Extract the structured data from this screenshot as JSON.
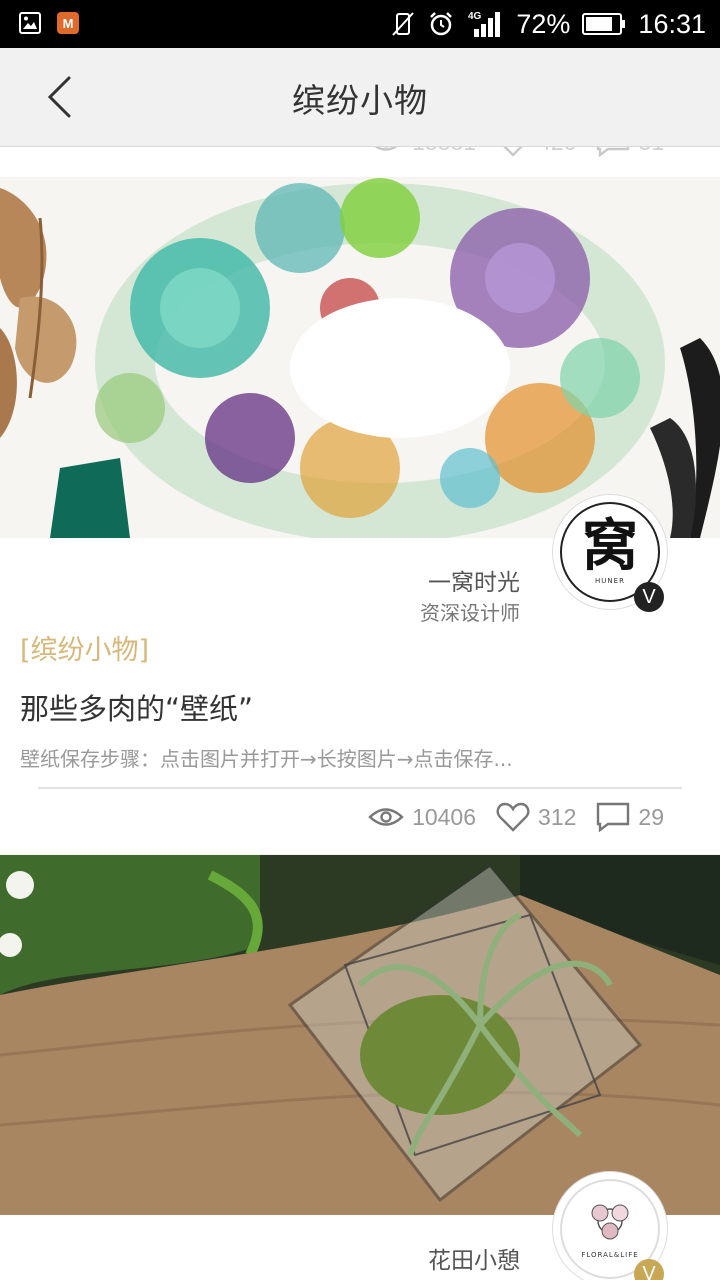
{
  "status_bar": {
    "battery": "72%",
    "time": "16:31",
    "network": "4G"
  },
  "nav": {
    "title": "缤纷小物"
  },
  "articles": [
    {
      "avatar_glyph": "窝",
      "avatar_text": "HUNER",
      "author": "一窝时光",
      "role": "资深设计师",
      "badge": "V",
      "tag": "[缤纷小物]",
      "title": "那些多肉的“壁纸”",
      "excerpt": "壁纸保存步骤：点击图片并打开→长按图片→点击保存...",
      "views": "10406",
      "likes": "312",
      "comments": "29"
    },
    {
      "avatar_text": "FLORAL&LIFE",
      "author": "花田小憩",
      "badge": "V"
    }
  ],
  "colors": {
    "tag": "#d8b87a",
    "badge_dark": "#222222",
    "badge_gold": "#c9a855"
  }
}
